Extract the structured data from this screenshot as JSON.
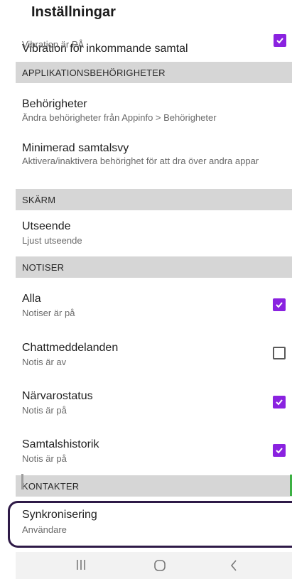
{
  "appbar": {
    "title": "Inställningar"
  },
  "top_item": {
    "title": "Vibration för inkommande samtal",
    "subtitle": "Vibration är PÅ",
    "checked": true
  },
  "sections": {
    "app_permissions": "APPLIKATIONSBEHÖRIGHETER",
    "screen": "SKÄRM",
    "notifications": "NOTISER",
    "contacts": "KONTAKTER"
  },
  "permissions": {
    "title": "Behörigheter",
    "subtitle": "Ändra behörigheter från Appinfo > Behörigheter"
  },
  "minimized": {
    "title": "Minimerad samtalsvy",
    "subtitle": "Aktivera/inaktivera behörighet för att dra över andra appar"
  },
  "appearance": {
    "title": "Utseende",
    "subtitle": "Ljust utseende"
  },
  "notif_items": [
    {
      "title": "Alla",
      "subtitle": "Notiser är på",
      "checked": true
    },
    {
      "title": "Chattmeddelanden",
      "subtitle": "Notis är av",
      "checked": false
    },
    {
      "title": "Närvarostatus",
      "subtitle": "Notis är på",
      "checked": true
    },
    {
      "title": "Samtalshistorik",
      "subtitle": "Notis är på",
      "checked": true
    }
  ],
  "sync": {
    "title": "Synkronisering",
    "subtitle": "Användare"
  },
  "colors": {
    "accent": "#8a22e0",
    "section_bg": "#d6d6d6",
    "highlight": "#2e1a47"
  },
  "navbar": {
    "icons": [
      "recent-apps-icon",
      "home-icon",
      "back-icon"
    ]
  }
}
